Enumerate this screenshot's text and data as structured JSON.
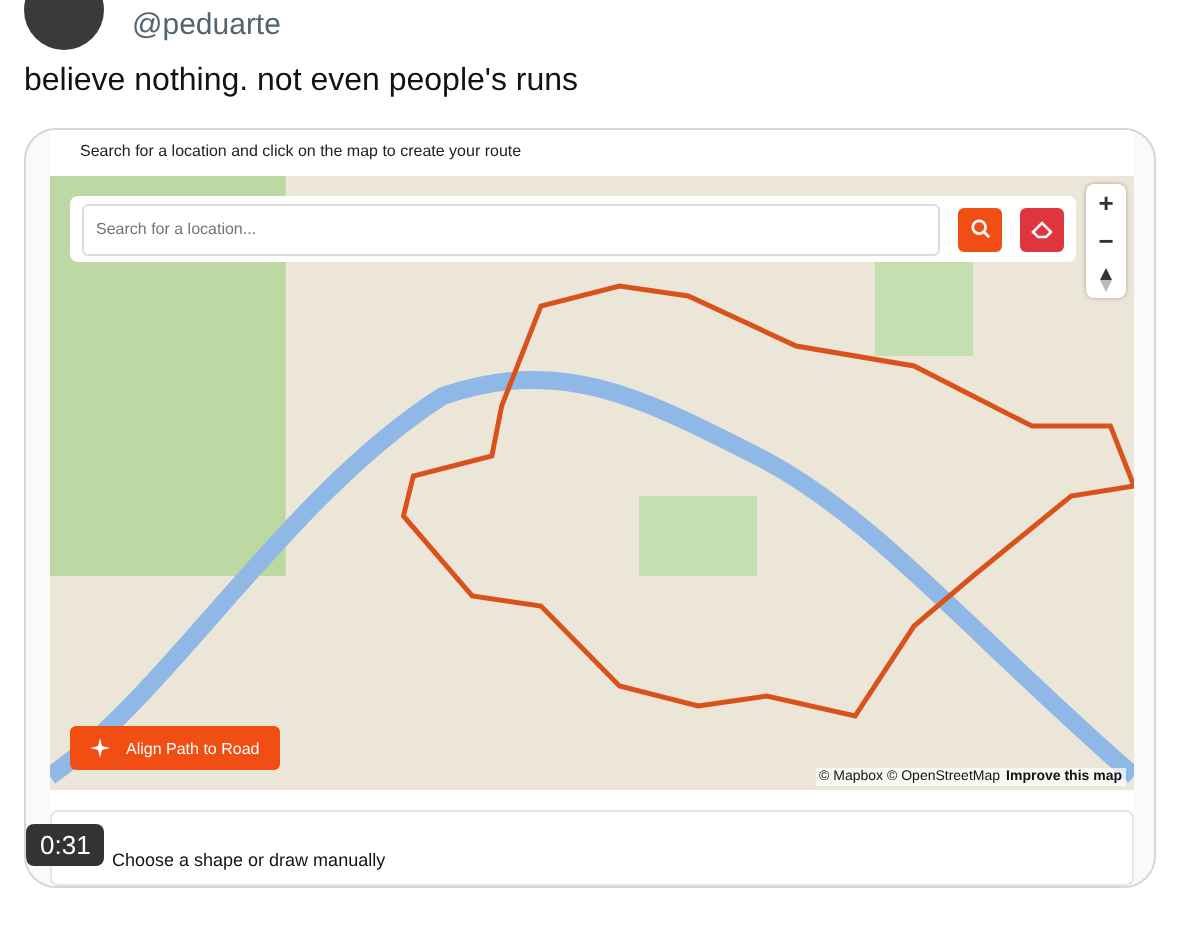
{
  "tweet": {
    "handle": "@peduarte",
    "text": "believe nothing. not even people's runs"
  },
  "video": {
    "timestamp": "0:31",
    "app": {
      "instruction": "Search for a location and click on the map to create your route",
      "search": {
        "placeholder": "Search for a location..."
      },
      "zoom_in": "+",
      "zoom_out": "−",
      "align_button": "Align Path to Road",
      "attribution": [
        "© Mapbox © OpenStreetMap",
        "Improve this map"
      ],
      "panel_label": "Choose a shape or draw manually"
    }
  }
}
